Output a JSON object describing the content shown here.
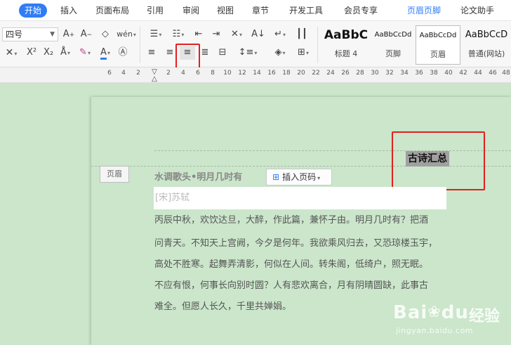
{
  "tabs": [
    {
      "label": "开始",
      "active": true
    },
    {
      "label": "插入"
    },
    {
      "label": "页面布局"
    },
    {
      "label": "引用"
    },
    {
      "label": "审阅"
    },
    {
      "label": "视图"
    },
    {
      "label": "章节"
    },
    {
      "label": "开发工具"
    },
    {
      "label": "会员专享"
    },
    {
      "label": "页眉页脚",
      "accent": true
    },
    {
      "label": "论文助手"
    }
  ],
  "ribbon": {
    "font_size": "四号",
    "grow_font": "A⁺",
    "shrink_font": "A⁻",
    "superscript": "X²",
    "subscript": "X₂",
    "pinyin": "wén"
  },
  "styles": [
    {
      "preview": "AaBbC",
      "name": "标题 4"
    },
    {
      "preview": "AaBbCcDd",
      "name": "页脚"
    },
    {
      "preview": "AaBbCcDd",
      "name": "页眉"
    },
    {
      "preview": "AaBbCcD",
      "name": "普通(网站)"
    }
  ],
  "ruler": {
    "labels": [
      "6",
      "4",
      "2",
      "2",
      "4",
      "6",
      "8",
      "10",
      "12",
      "14",
      "16",
      "18",
      "20",
      "22",
      "24",
      "26",
      "28",
      "30",
      "32",
      "34",
      "36",
      "38",
      "40",
      "42",
      "44",
      "46",
      "48"
    ]
  },
  "document": {
    "header_tag": "页眉",
    "header_text": "古诗汇总",
    "title": "水调歌头•明月几时有",
    "insert_page_number": "插入页码",
    "author": "[宋]苏轼",
    "paragraph_lines": [
      "丙辰中秋，欢饮达旦，大醉，作此篇，兼怀子由。明月几时有？把酒",
      "问青天。不知天上宫阙，今夕是何年。我欲乘风归去，又恐琼楼玉宇，",
      "高处不胜寒。起舞弄清影，何似在人间。转朱阁，低绮户，照无眠。",
      "不应有恨，何事长向别时圆？人有悲欢离合，月有阴晴圆缺，此事古",
      "难全。但愿人长久，千里共婵娟。"
    ]
  },
  "watermark": {
    "brand": "Bai",
    "brand2": "du",
    "cn": "经验",
    "url": "jingyan.baidu.com"
  }
}
